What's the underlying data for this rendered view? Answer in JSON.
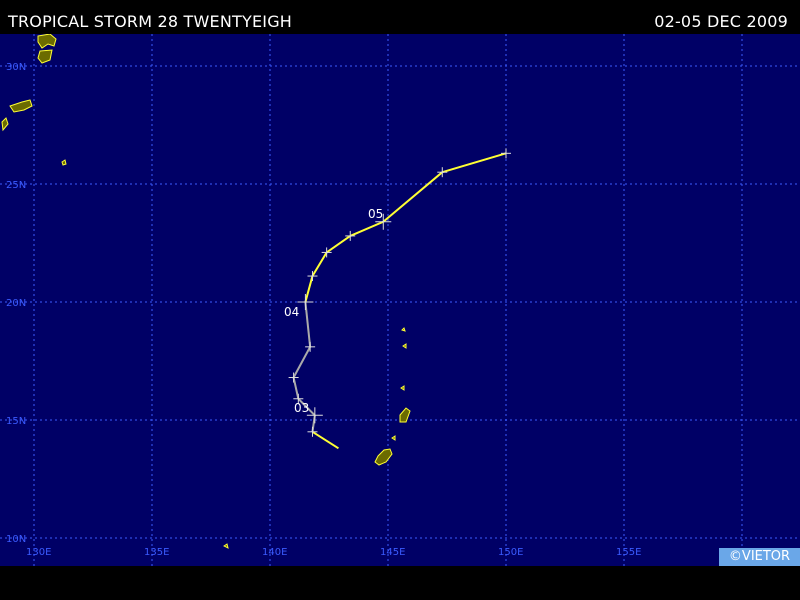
{
  "header": {
    "storm_name": "TROPICAL STORM 28 TWENTYEIGH",
    "date_range": "02-05 DEC 2009"
  },
  "map": {
    "background_color": "#000066",
    "grid_color": "#3b5bff",
    "land_color": "#6b6b00",
    "coast_color": "#ffff33",
    "lat_labels": [
      "10N",
      "15N",
      "20N",
      "25N",
      "30N"
    ],
    "lon_labels": [
      "130E",
      "135E",
      "140E",
      "145E",
      "150E",
      "155E",
      "160E"
    ]
  },
  "track": {
    "line_colors": {
      "earlier": "#aaaaaa",
      "later": "#ffff33"
    },
    "day_labels": [
      "03",
      "04",
      "05"
    ],
    "points": [
      {
        "lat": 13.8,
        "lon": 142.9
      },
      {
        "lat": 14.5,
        "lon": 141.8
      },
      {
        "lat": 15.2,
        "lon": 141.9
      },
      {
        "lat": 15.9,
        "lon": 141.2
      },
      {
        "lat": 16.8,
        "lon": 141.0
      },
      {
        "lat": 18.1,
        "lon": 141.7
      },
      {
        "lat": 20.0,
        "lon": 141.5
      },
      {
        "lat": 21.1,
        "lon": 141.8
      },
      {
        "lat": 22.1,
        "lon": 142.4
      },
      {
        "lat": 22.8,
        "lon": 143.4
      },
      {
        "lat": 23.4,
        "lon": 144.8
      },
      {
        "lat": 25.5,
        "lon": 147.3
      },
      {
        "lat": 26.3,
        "lon": 150.0
      }
    ]
  },
  "watermark": "©VIETOR"
}
